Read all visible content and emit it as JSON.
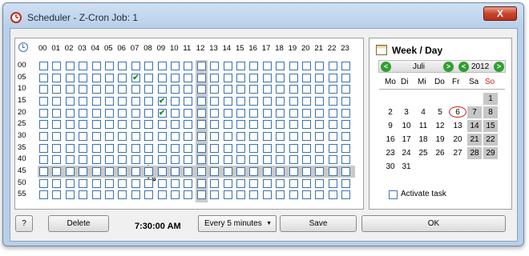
{
  "window": {
    "title": "Scheduler - Z-Cron Job: 1",
    "close_label": "X"
  },
  "grid": {
    "hours": [
      "00",
      "01",
      "02",
      "03",
      "04",
      "05",
      "06",
      "07",
      "08",
      "09",
      "10",
      "11",
      "12",
      "13",
      "14",
      "15",
      "16",
      "17",
      "18",
      "19",
      "20",
      "21",
      "22",
      "23"
    ],
    "minutes": [
      "00",
      "05",
      "10",
      "15",
      "20",
      "25",
      "30",
      "35",
      "40",
      "45",
      "50",
      "55"
    ],
    "checked": [
      [
        1,
        7
      ],
      [
        3,
        9
      ],
      [
        4,
        9
      ]
    ],
    "highlight_hour": "12",
    "highlight_minute": "45",
    "scroll_glyph": "^"
  },
  "calendar": {
    "title": "Week / Day",
    "month": "Juli",
    "year": "2012",
    "weekdays": [
      "Mo",
      "Di",
      "Mi",
      "Do",
      "Fr",
      "Sa",
      "So"
    ],
    "weeks": [
      [
        "",
        "",
        "",
        "",
        "",
        "",
        "1"
      ],
      [
        "2",
        "3",
        "4",
        "5",
        "6",
        "7",
        "8"
      ],
      [
        "9",
        "10",
        "11",
        "12",
        "13",
        "14",
        "15"
      ],
      [
        "16",
        "17",
        "18",
        "19",
        "20",
        "21",
        "22"
      ],
      [
        "23",
        "24",
        "25",
        "26",
        "27",
        "28",
        "29"
      ],
      [
        "30",
        "31",
        "",
        "",
        "",
        "",
        ""
      ]
    ],
    "selected_day": "6",
    "activate_label": "Activate task",
    "prev_glyph": "<",
    "next_glyph": ">"
  },
  "footer": {
    "help_label": "?",
    "delete_label": "Delete",
    "time": "7:30:00 AM",
    "interval": "Every 5 minutes",
    "dropdown_arrow": "▼",
    "save_label": "Save",
    "ok_label": "OK"
  },
  "colors": {
    "accent": "#3c72b0",
    "check": "#1f8f1f",
    "nav_green": "#2f9f2f",
    "circle": "#d02020"
  }
}
